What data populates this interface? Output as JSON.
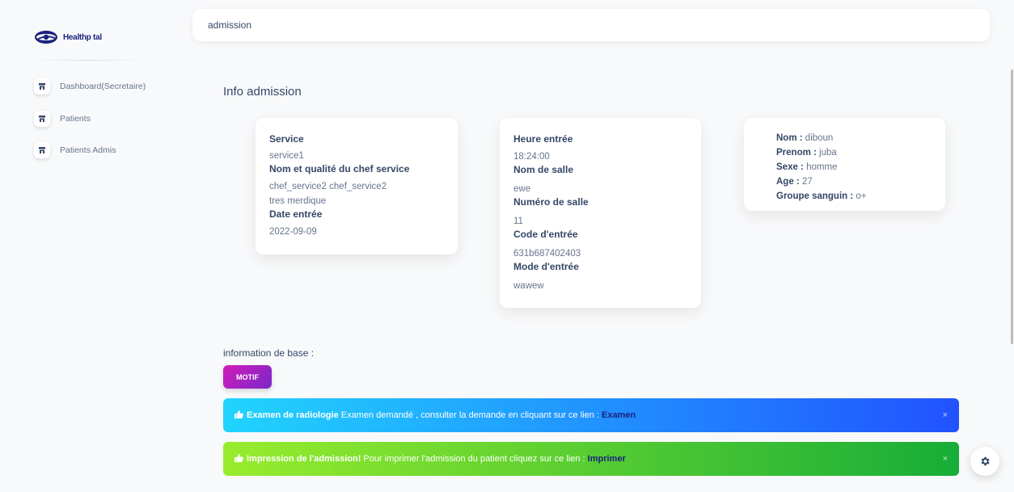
{
  "brand": {
    "name": "Healthp tal"
  },
  "sidebar": {
    "items": [
      {
        "label": "Dashboard(Secretaire)",
        "icon": "store-icon"
      },
      {
        "label": "Patients",
        "icon": "store-icon"
      },
      {
        "label": "Patients Admis",
        "icon": "store-icon"
      }
    ]
  },
  "topbar": {
    "title": "admission"
  },
  "main": {
    "section_title": "Info admission",
    "card1": {
      "service_label": "Service",
      "service_value": "service1",
      "chef_label": "Nom et qualité du chef service",
      "chef_value": "chef_service2 chef_service2",
      "chef_quality": "tres merdique",
      "date_label": "Date entrée",
      "date_value": "2022-09-09"
    },
    "card2": {
      "heure_label": "Heure entrée",
      "heure_value": "18:24:00",
      "salle_label": "Nom de salle",
      "salle_value": "ewe",
      "numero_label": "Numéro de salle",
      "numero_value": "11",
      "code_label": "Code d'entrée",
      "code_value": "631b687402403",
      "mode_label": "Mode d'entrée",
      "mode_value": "wawew"
    },
    "card3": {
      "nom_label": "Nom :",
      "nom_value": "diboun",
      "prenom_label": "Prenom :",
      "prenom_value": "juba",
      "sexe_label": "Sexe :",
      "sexe_value": "homme",
      "age_label": "Age :",
      "age_value": "27",
      "groupe_label": "Groupe sanguin :",
      "groupe_value": "o+"
    },
    "base_label": "information de base :",
    "motif_button": "MOTIF",
    "alerts": {
      "radiologie": {
        "title": "Examen de radiologie",
        "text": " Examen demandé , consulter la demande en cliquant sur ce lien : ",
        "link": "Examen",
        "close": "×"
      },
      "impression": {
        "title": "Impression de l'admission!",
        "text": " Pour imprimer l'admission du patient cliquez sur ce lien : ",
        "link": "Imprimer",
        "close": "×"
      }
    }
  },
  "colors": {
    "accent_pink": "#d21cb8",
    "accent_purple": "#7928ca",
    "info_start": "#21d4fd",
    "info_end": "#2152ff",
    "success_start": "#98ec2d",
    "success_end": "#17ad37",
    "heading": "#344767",
    "text": "#67748e"
  }
}
